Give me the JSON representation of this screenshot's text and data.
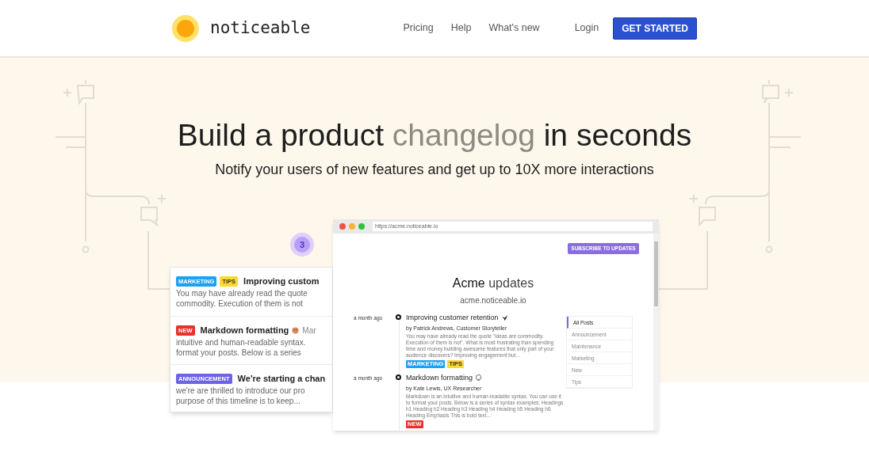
{
  "header": {
    "logo": "noticeable",
    "nav": [
      {
        "label": "Pricing",
        "kind": "link"
      },
      {
        "label": "Help",
        "kind": "link"
      },
      {
        "label": "What's new",
        "kind": "link"
      },
      {
        "label": "Login",
        "kind": "link"
      },
      {
        "label": "GET STARTED",
        "kind": "button"
      }
    ]
  },
  "hero": {
    "title_start": "Build a product ",
    "title_highlight": "changelog",
    "title_end": " in seconds",
    "subtitle": "Notify your users of new features and get up to 10X more interactions"
  },
  "widget": {
    "badge": "3",
    "items": [
      {
        "tags": [
          {
            "label": "MARKETING",
            "color": "#1ea1f1"
          },
          {
            "label": "TIPS",
            "color": "#fcd932"
          }
        ],
        "title": "Improving custom",
        "lines": [
          "You may have already read the quote",
          "commodity. Execution of them is not"
        ]
      },
      {
        "tags": [
          {
            "label": "NEW",
            "color": "#e5332a"
          }
        ],
        "title": "Markdown formatting",
        "lead": "Mar",
        "lines": [
          "intuitive and human-readable syntax.",
          "format your posts. Below is a series"
        ]
      },
      {
        "tags": [
          {
            "label": "ANNOUNCEMENT",
            "color": "#6c63e6"
          }
        ],
        "title": "We're starting a chan",
        "lines": [
          "we're are thrilled to introduce our pro",
          "purpose of this timeline is to keep..."
        ]
      }
    ]
  },
  "browser": {
    "url": "https://acme.noticeable.io",
    "subscribe": "SUBSCRIBE TO UPDATES",
    "title_brand": "Acme",
    "title_rest": "updates",
    "domain": "acme.noticeable.io",
    "posts": [
      {
        "time": "a month ago",
        "title": "Improving customer retention",
        "author": "by Patrick Andrews, Customer Storyteller",
        "excerpt": "You may have already read the quote \"Ideas are commodity. Execution of them is not\". What is most frustrating than spending time and money building awesome features that only part of your audience discovers? Improving engagement but...",
        "tags": [
          {
            "label": "MARKETING",
            "color": "#1ea1f1"
          },
          {
            "label": "TIPS",
            "color": "#fcd932"
          }
        ]
      },
      {
        "time": "a month ago",
        "title": "Markdown formatting",
        "author": "by Kate Lewis, UX Researcher",
        "excerpt": "Markdown is an intuitive and human-readable syntax. You can use it to format your posts. Below is a series of syntax examples: Headings h1 Heading h2 Heading h3 Heading h4 Heading h5 Heading h6 Heading Emphasis This is bold text...",
        "tags": [
          {
            "label": "NEW",
            "color": "#e5332a"
          }
        ]
      }
    ],
    "categories": [
      {
        "label": "All Posts",
        "selected": true
      },
      {
        "label": "Announcement",
        "selected": false
      },
      {
        "label": "Maintenance",
        "selected": false
      },
      {
        "label": "Marketing",
        "selected": false
      },
      {
        "label": "New",
        "selected": false
      },
      {
        "label": "Tips",
        "selected": false
      }
    ]
  }
}
